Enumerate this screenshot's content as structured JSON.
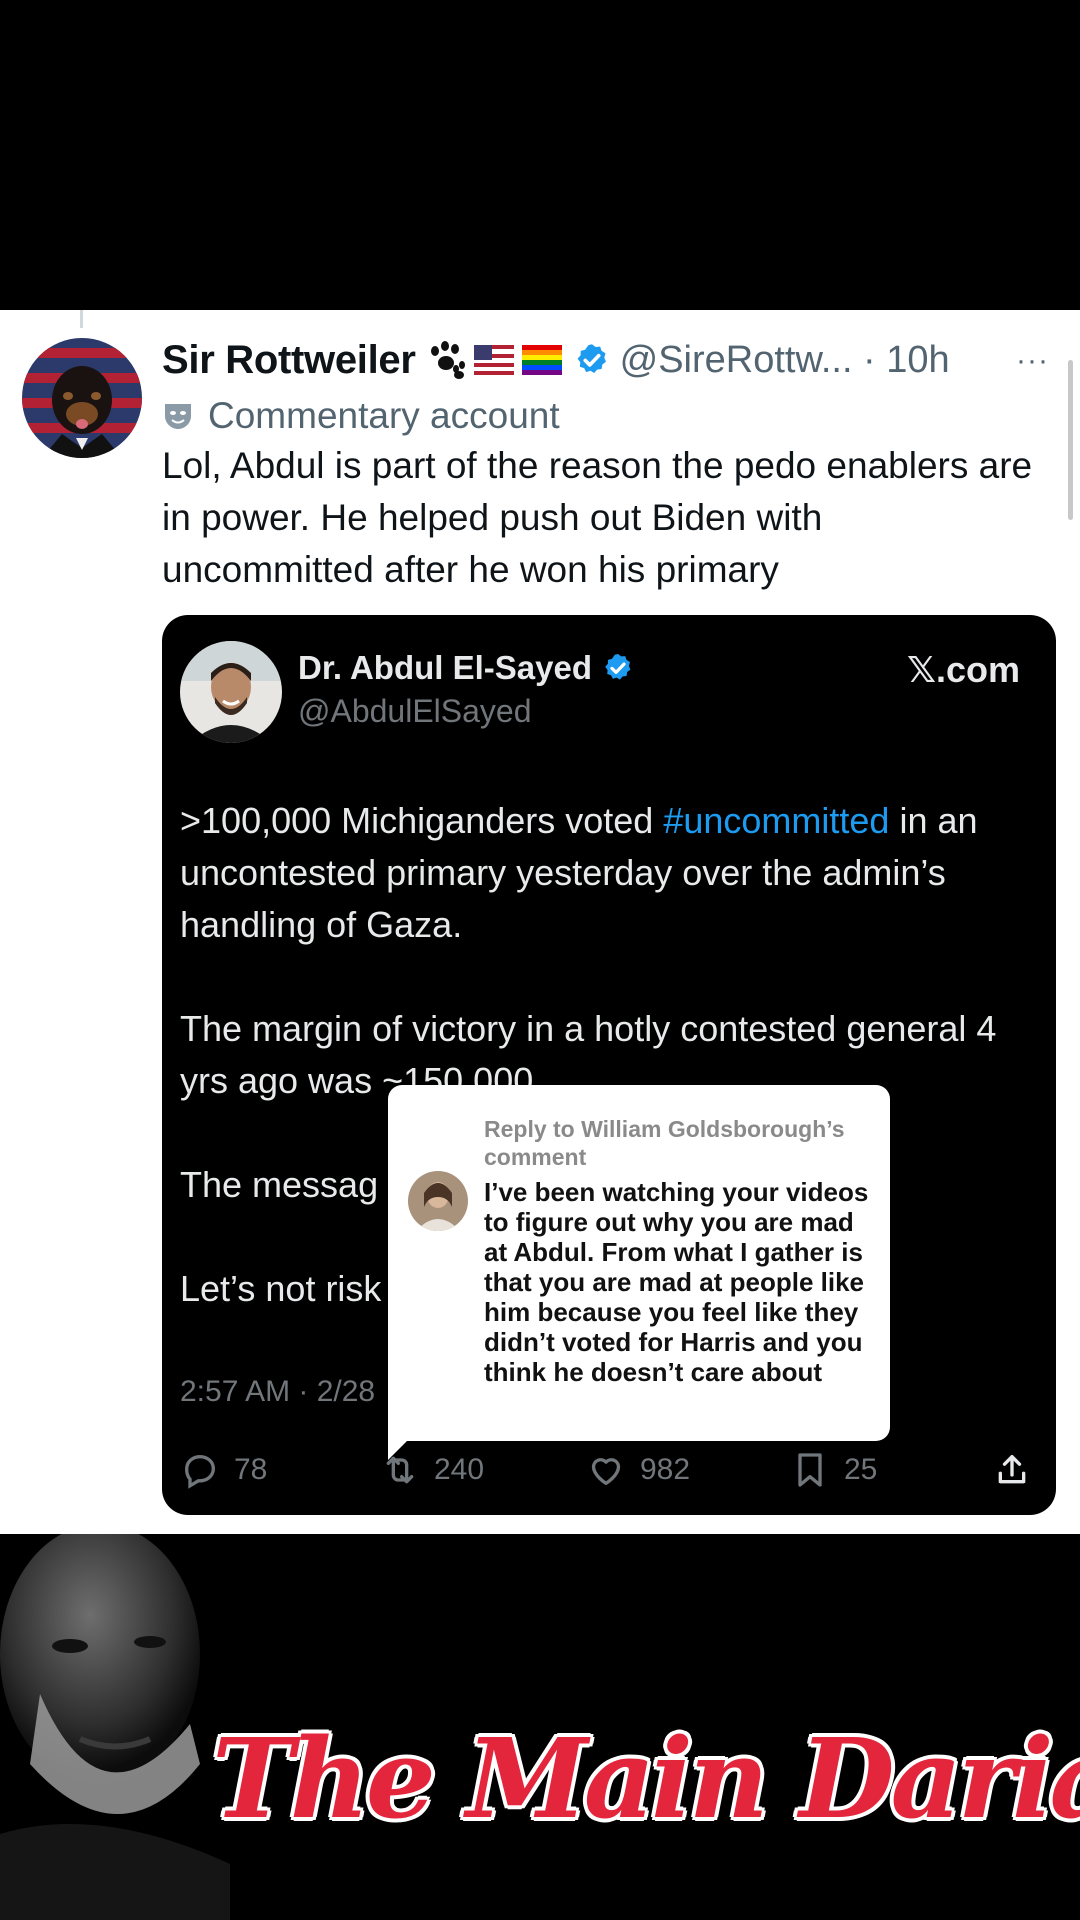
{
  "tweet": {
    "display_name": "Sir Rottweiler",
    "handle_time": "@SireRottw... · 10h",
    "label_text": "Commentary account",
    "body": "Lol, Abdul is part of the reason the pedo enablers are in power. He helped push out Biden with uncommitted after he won his primary",
    "more": "···"
  },
  "quoted": {
    "name": "Dr. Abdul El-Sayed",
    "handle": "@AbdulElSayed",
    "site": "𝕏.com",
    "para1_before": ">100,000 Michiganders voted ",
    "hashtag": "#uncommitted",
    "para1_after": " in an uncontested primary yesterday over the admin’s handling of Gaza.",
    "para2": "The margin of victory in a hotly contested general 4 yrs ago was ~150,000.",
    "para3": "The messag",
    "para4": "Let’s not risk",
    "time": "2:57 AM · 2/28",
    "stats": {
      "replies": "78",
      "reposts": "240",
      "likes": "982",
      "bookmarks": "25"
    }
  },
  "reply_popup": {
    "heading": "Reply to William Goldsborough’s comment",
    "body": "I’ve been watching your videos to figure out why you are mad at Abdul. From what I gather is that you are mad at people like him because you feel like they didn’t voted for Harris and you think he doesn’t care about"
  },
  "overlay": {
    "channel_name": "The Main Darian"
  },
  "colors": {
    "link_blue": "#1d9bf0",
    "verified_blue": "#1d9bf0",
    "title_red": "#e3263c"
  }
}
